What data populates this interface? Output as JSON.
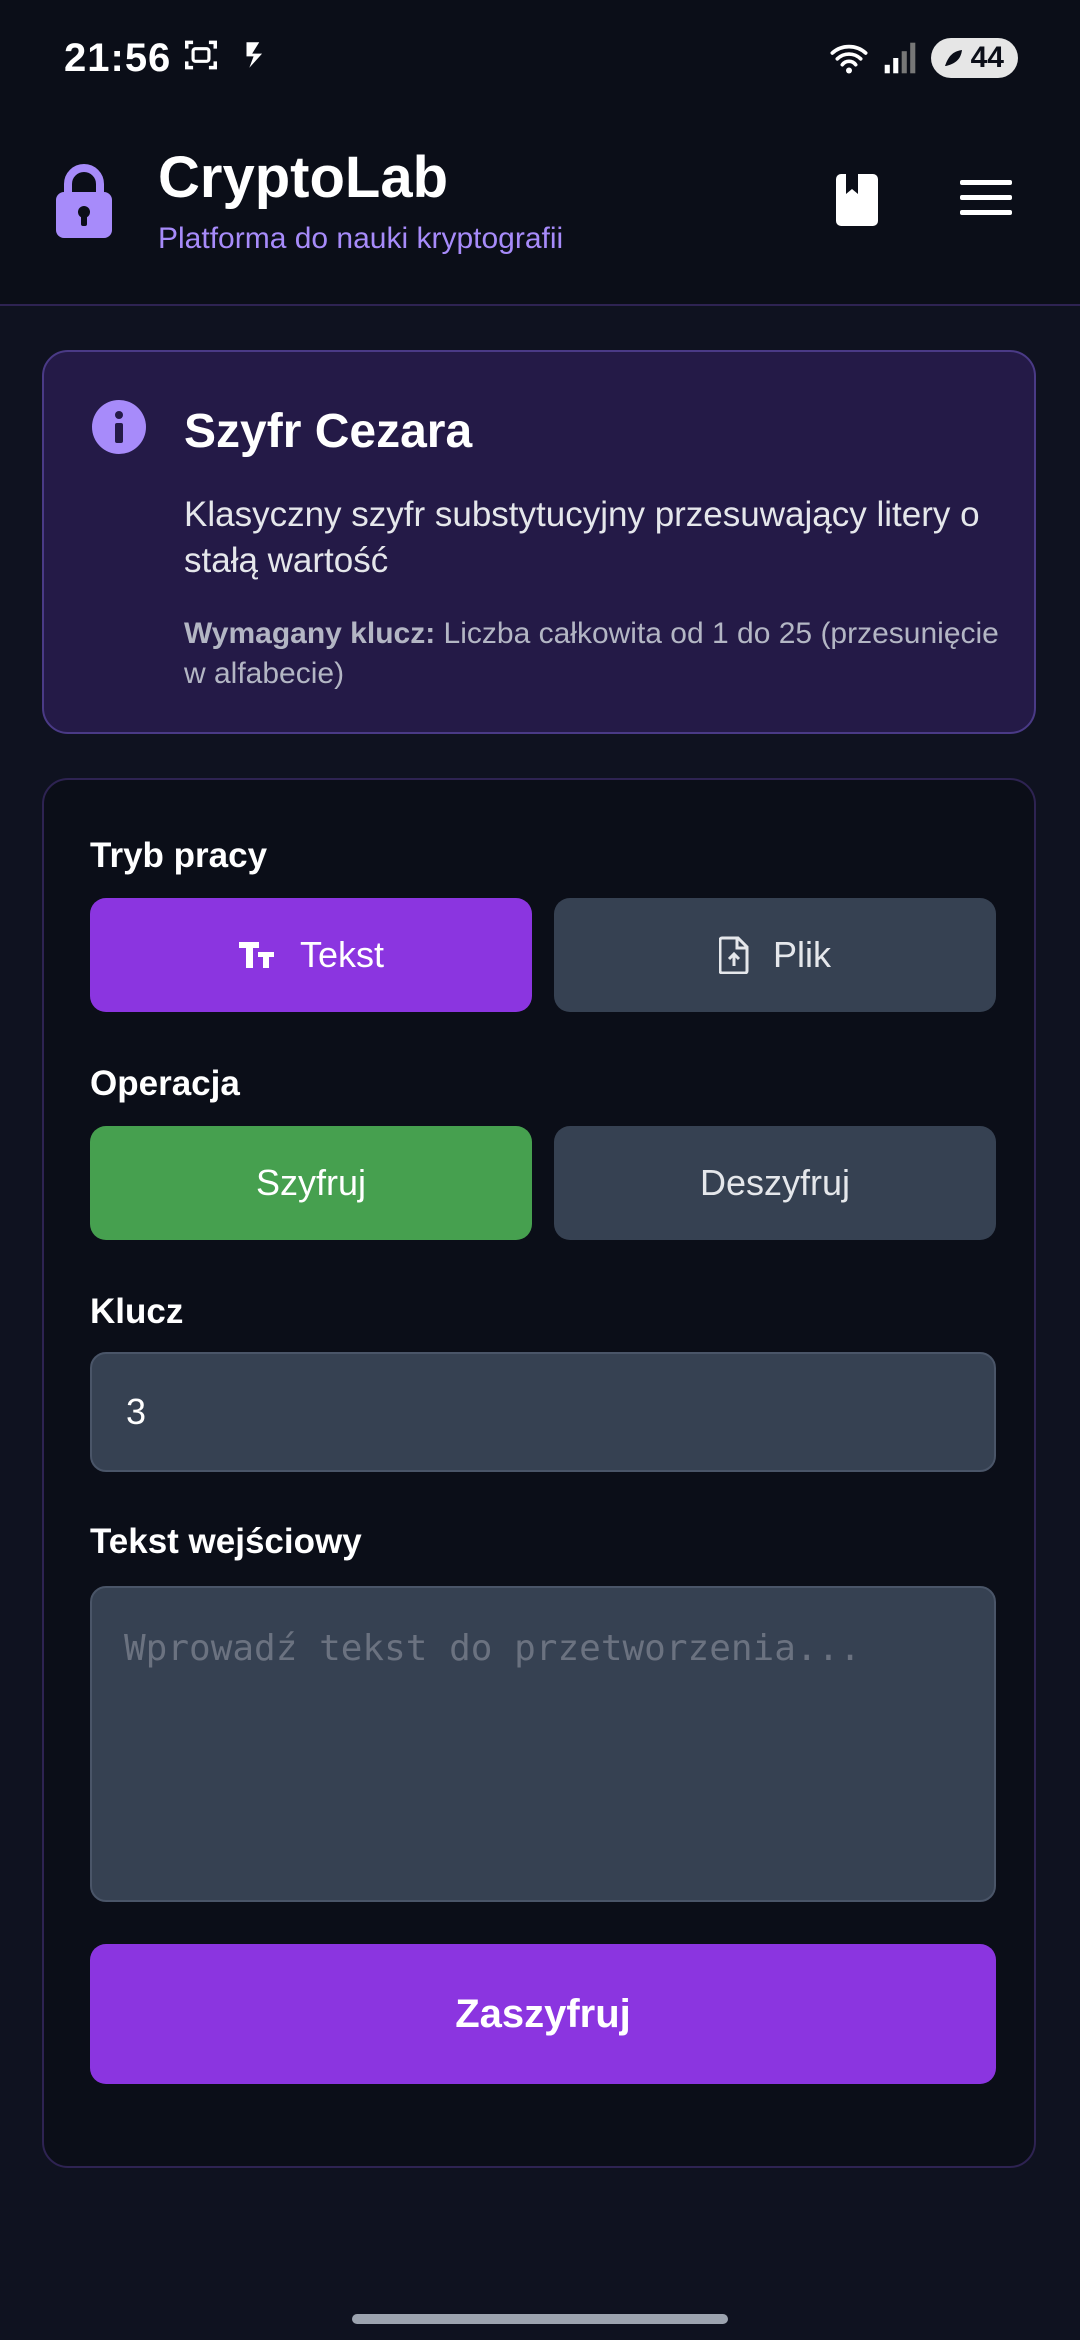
{
  "status": {
    "time": "21:56",
    "battery": "44"
  },
  "header": {
    "title": "CryptoLab",
    "subtitle": "Platforma do nauki kryptografii"
  },
  "info": {
    "title": "Szyfr Cezara",
    "description": "Klasyczny szyfr substytucyjny przesuwający litery o stałą wartość",
    "key_label": "Wymagany klucz:",
    "key_text": " Liczba całkowita od 1 do 25 (przesunięcie w alfabecie)"
  },
  "form": {
    "mode_label": "Tryb pracy",
    "mode_options": [
      "Tekst",
      "Plik"
    ],
    "mode_selected": "Tekst",
    "operation_label": "Operacja",
    "operation_options": [
      "Szyfruj",
      "Deszyfruj"
    ],
    "operation_selected": "Szyfruj",
    "key_label": "Klucz",
    "key_value": "3",
    "input_label": "Tekst wejściowy",
    "input_placeholder": "Wprowadź tekst do przetworzenia...",
    "submit_label": "Zaszyfruj"
  },
  "colors": {
    "accent": "#8b35e0",
    "success": "#46a04f",
    "info_bg": "#241a47",
    "subtitle": "#a78bfa"
  }
}
